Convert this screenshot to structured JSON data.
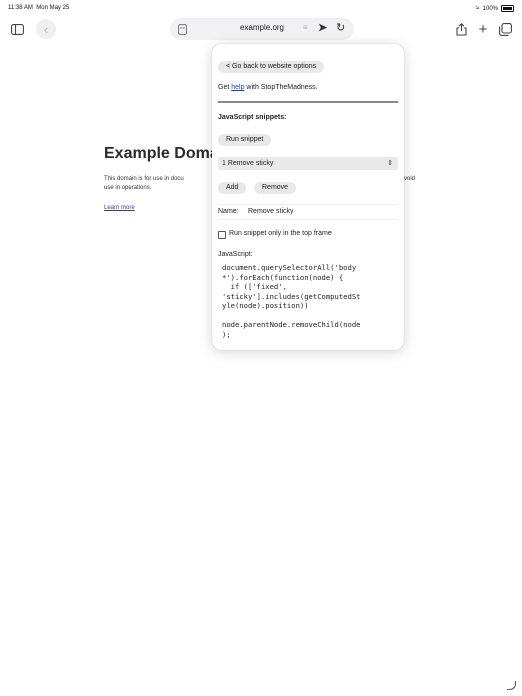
{
  "status_bar": {
    "time": "11:38 AM",
    "date": "Mon May 25",
    "battery": "100%"
  },
  "toolbar": {
    "url": "example.org",
    "icons": [
      "sidebar-icon",
      "back-icon",
      "tab-icon",
      "reader-icon",
      "extension-icon",
      "reload-icon",
      "share-icon",
      "plus-icon",
      "tabs-overview-icon"
    ]
  },
  "page": {
    "title": "Example Doma",
    "paragraph_line1": "This domain is for use in docu",
    "paragraph_line1_tail": "void",
    "paragraph_line2": "use in operations.",
    "link": "Learn more"
  },
  "popover": {
    "back_button": "< Go back to website options",
    "help_prefix": "Get ",
    "help_link": "help",
    "help_suffix": " with StopTheMadness.",
    "snippets_heading": "JavaScript snippets:",
    "run_button": "Run snippet",
    "selected_snippet": "1 Remove sticky",
    "add_button": "Add",
    "remove_button": "Remove",
    "name_label": "Name:",
    "name_value": "Remove sticky",
    "top_frame_checkbox": "Run snippet only in the top frame",
    "top_frame_checked": false,
    "javascript_label": "JavaScript:",
    "code": "document.querySelectorAll('body\n*').forEach(function(node) {\n  if (['fixed',\n'sticky'].includes(getComputedSt\nyle(node).position))\n\nnode.parentNode.removeChild(node\n);"
  },
  "colors": {
    "link": "#1a3ec9",
    "pill_bg": "#e8e8ea",
    "urlbar_bg": "#f1f1f3"
  }
}
